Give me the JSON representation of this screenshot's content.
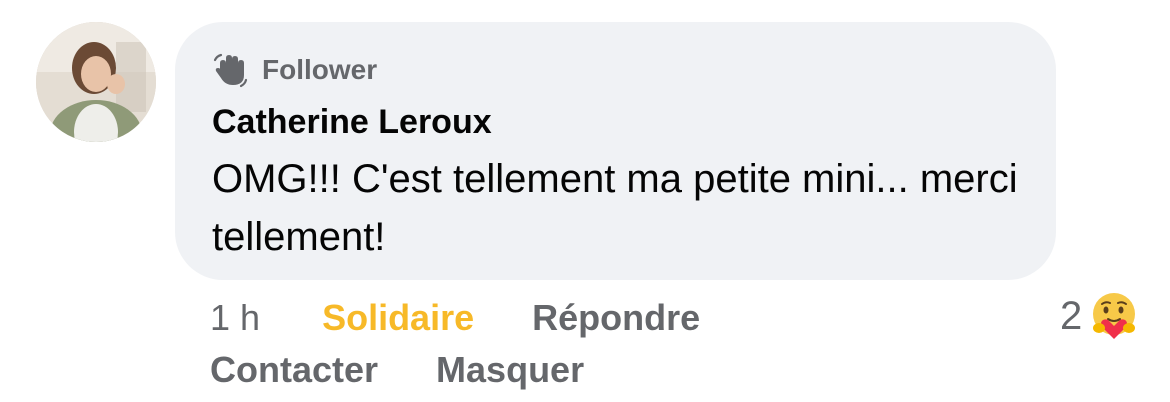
{
  "comment": {
    "badge": "Follower",
    "author": "Catherine Leroux",
    "text": "OMG!!! C'est tellement ma petite mini... merci tellement!",
    "time": "1 h",
    "actions": {
      "support": "Solidaire",
      "reply": "Répondre",
      "contact": "Contacter",
      "hide": "Masquer"
    },
    "reaction_count": "2",
    "reaction_icon": "care-emoji-icon"
  },
  "colors": {
    "bubble": "#f0f2f5",
    "secondary_text": "#65676b",
    "support_active": "#f7b928",
    "primary_text": "#050505"
  }
}
